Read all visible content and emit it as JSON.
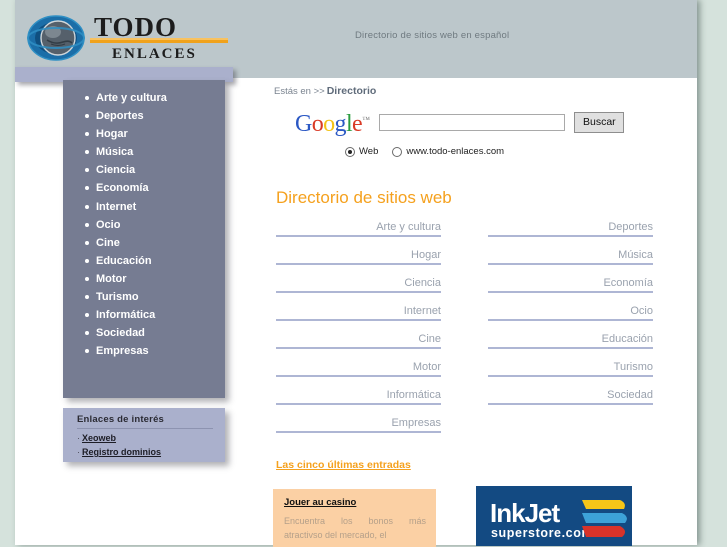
{
  "site": {
    "logo_word_top": "TODO",
    "logo_word_bottom": "ENLACES",
    "tagline": "Directorio de sitios web en español"
  },
  "sidebar": {
    "items": [
      {
        "label": "Arte y cultura"
      },
      {
        "label": "Deportes"
      },
      {
        "label": "Hogar"
      },
      {
        "label": "Música"
      },
      {
        "label": "Ciencia"
      },
      {
        "label": "Economía"
      },
      {
        "label": "Internet"
      },
      {
        "label": "Ocio"
      },
      {
        "label": "Cine"
      },
      {
        "label": "Educación"
      },
      {
        "label": "Motor"
      },
      {
        "label": "Turismo"
      },
      {
        "label": "Informática"
      },
      {
        "label": "Sociedad"
      },
      {
        "label": "Empresas"
      }
    ],
    "enlaces": {
      "title": "Enlaces de interés",
      "dash": "·",
      "links": [
        {
          "label": "Xeoweb"
        },
        {
          "label": "Registro dominios"
        }
      ]
    }
  },
  "breadcrumb": {
    "prefix": "Estás en >>",
    "current": "Directorio"
  },
  "search": {
    "logo_letters": [
      {
        "ch": "G",
        "color_class": "b"
      },
      {
        "ch": "o",
        "color_class": "r"
      },
      {
        "ch": "o",
        "color_class": "y"
      },
      {
        "ch": "g",
        "color_class": "b"
      },
      {
        "ch": "l",
        "color_class": "g"
      },
      {
        "ch": "e",
        "color_class": "r"
      }
    ],
    "trademark": "™",
    "input_value": "",
    "placeholder": "",
    "button_label": "Buscar",
    "scope_options": [
      {
        "label": "Web",
        "selected": true
      },
      {
        "label": "www.todo-enlaces.com",
        "selected": false
      }
    ]
  },
  "main": {
    "title": "Directorio de sitios web",
    "directory_rows": [
      {
        "left": "Arte y cultura",
        "right": "Deportes"
      },
      {
        "left": "Hogar",
        "right": "Música"
      },
      {
        "left": "Ciencia",
        "right": "Economía"
      },
      {
        "left": "Internet",
        "right": "Ocio"
      },
      {
        "left": "Cine",
        "right": "Educación"
      },
      {
        "left": "Motor",
        "right": "Turismo"
      },
      {
        "left": "Informática",
        "right": "Sociedad"
      },
      {
        "left": "Empresas",
        "right": ""
      }
    ],
    "latest_link": "Las cinco últimas entradas"
  },
  "promo": {
    "casino": {
      "title": "Jouer au casino",
      "text": "Encuentra los bonos más atractivso del mercado, el"
    },
    "inkjet": {
      "wordmark": "InkJet",
      "subtitle": "superstore.com",
      "bg_color": "#134a82",
      "swoosh_colors": [
        "#f5c518",
        "#3da2d8",
        "#d8332a"
      ]
    }
  },
  "colors": {
    "page_bg": "#d5e2dc",
    "header_bg": "#bcc7cb",
    "sidebar_bg": "#767c92",
    "sidebar_topbar": "#aab0cc",
    "accent_orange": "#f5a11e",
    "link_grey": "#9aa2ae",
    "rule_color": "#aeb6d4",
    "casino_bg": "#fbd0a4"
  }
}
